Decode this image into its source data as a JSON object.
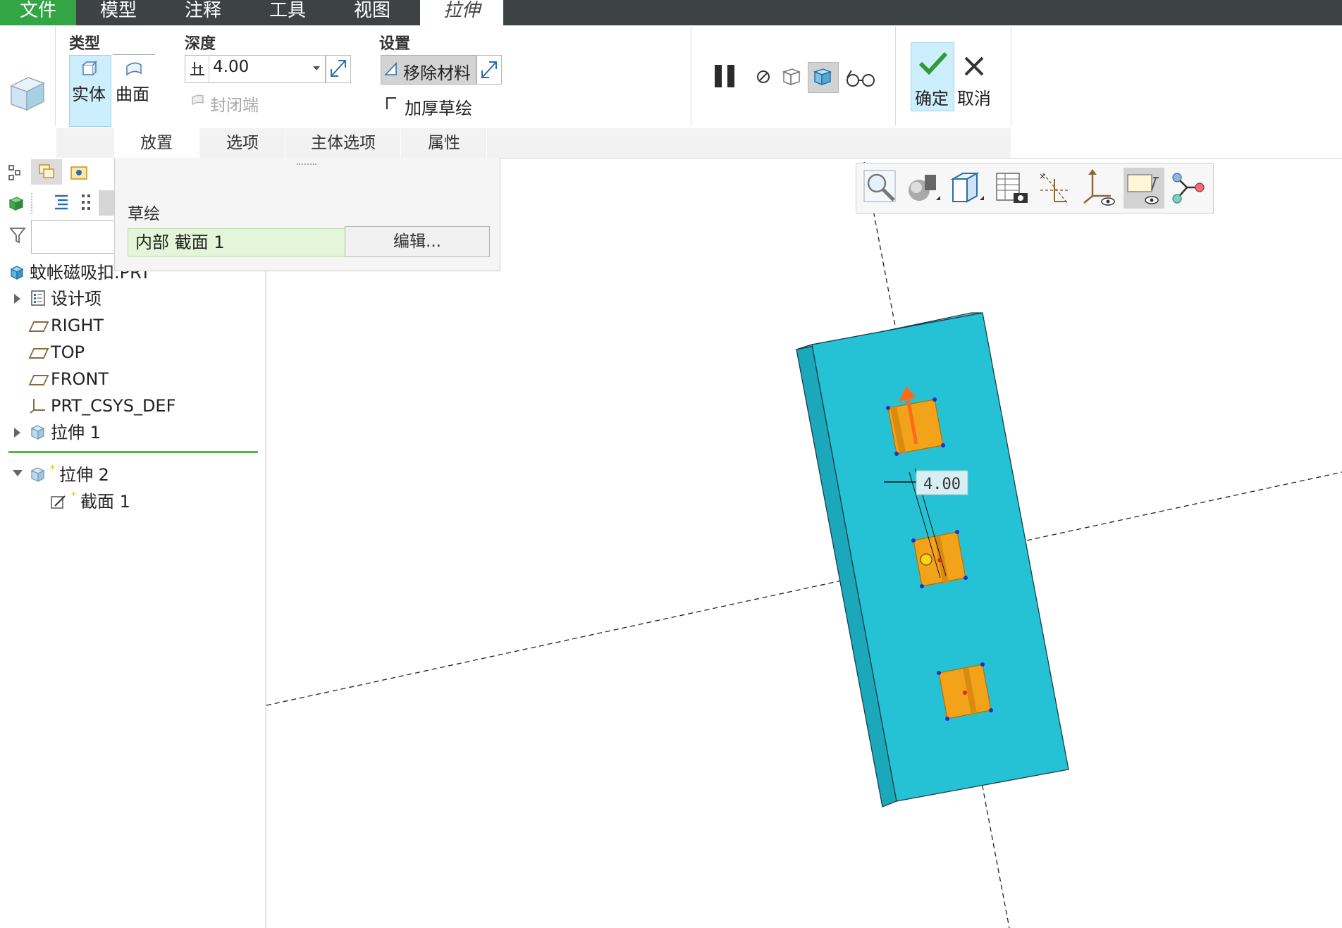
{
  "menu": {
    "tabs": [
      {
        "label": "文件"
      },
      {
        "label": "模型"
      },
      {
        "label": "注释"
      },
      {
        "label": "工具"
      },
      {
        "label": "视图"
      },
      {
        "label": "拉伸"
      }
    ]
  },
  "ribbon": {
    "type_group": {
      "title": "类型",
      "solid_label": "实体",
      "surface_label": "曲面"
    },
    "depth_group": {
      "title": "深度",
      "depth_value": "4.00",
      "capped_ends_label": "封闭端"
    },
    "settings_group": {
      "title": "设置",
      "remove_material_label": "移除材料",
      "thicken_sketch_label": "加厚草绘"
    },
    "ok_label": "确定",
    "cancel_label": "取消"
  },
  "subtabs": [
    {
      "label": "放置"
    },
    {
      "label": "选项"
    },
    {
      "label": "主体选项"
    },
    {
      "label": "属性"
    }
  ],
  "placement_panel": {
    "sketch_label": "草绘",
    "sketch_value": "内部 截面 1",
    "edit_label": "编辑..."
  },
  "model_tree": {
    "root": "蚊帐磁吸扣.PRT",
    "items": [
      {
        "label": "设计项"
      },
      {
        "label": "RIGHT"
      },
      {
        "label": "TOP"
      },
      {
        "label": "FRONT"
      },
      {
        "label": "PRT_CSYS_DEF"
      },
      {
        "label": "拉伸 1"
      },
      {
        "label": "拉伸 2"
      },
      {
        "label": "截面 1"
      }
    ]
  },
  "viewport": {
    "dimension_label": "4.00",
    "colors": {
      "body": "#24c2d4",
      "feature": "#f2a31a",
      "accent": "#34a544"
    }
  }
}
